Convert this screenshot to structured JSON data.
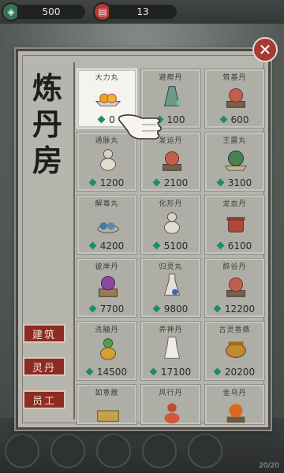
{
  "currencies": [
    {
      "icon": "jade-coin-icon",
      "value": "500"
    },
    {
      "icon": "red-talisman-icon",
      "value": "13"
    }
  ],
  "panel": {
    "title_chars": [
      "炼",
      "丹",
      "房"
    ],
    "side_tabs": [
      "建筑",
      "灵丹",
      "员工"
    ]
  },
  "items": [
    {
      "name": "大力丸",
      "price": "0",
      "icon": "dumpling-bowl-icon"
    },
    {
      "name": "避痨丹",
      "price": "100",
      "icon": "herb-vase-icon"
    },
    {
      "name": "筑基丹",
      "price": "600",
      "icon": "pill-pedestal-icon"
    },
    {
      "name": "通脉丸",
      "price": "1200",
      "icon": "gourd-icon"
    },
    {
      "name": "发运丹",
      "price": "2100",
      "icon": "pill-pedestal-icon"
    },
    {
      "name": "王露丸",
      "price": "3100",
      "icon": "leaf-plate-icon"
    },
    {
      "name": "解毒丸",
      "price": "4200",
      "icon": "blue-pills-icon"
    },
    {
      "name": "化形丹",
      "price": "5100",
      "icon": "gourd-icon"
    },
    {
      "name": "龙血丹",
      "price": "6100",
      "icon": "lidded-urn-icon"
    },
    {
      "name": "彼岸丹",
      "price": "7700",
      "icon": "purple-orb-box-icon"
    },
    {
      "name": "归灵丸",
      "price": "9800",
      "icon": "potion-bottle-icon"
    },
    {
      "name": "醉谷丹",
      "price": "12200",
      "icon": "pill-pedestal-icon"
    },
    {
      "name": "洗髓丹",
      "price": "14500",
      "icon": "green-gourd-icon"
    },
    {
      "name": "养神丹",
      "price": "17100",
      "icon": "white-vase-icon"
    },
    {
      "name": "古灵香鼎",
      "price": "20200",
      "icon": "incense-cauldron-icon"
    },
    {
      "name": "如意散",
      "price": "",
      "icon": "gold-box-icon"
    },
    {
      "name": "风行丹",
      "price": "",
      "icon": "red-gourd-icon"
    },
    {
      "name": "金乌丹",
      "price": "",
      "icon": "orange-pill-icon"
    }
  ],
  "bottom_counter": "20/20"
}
